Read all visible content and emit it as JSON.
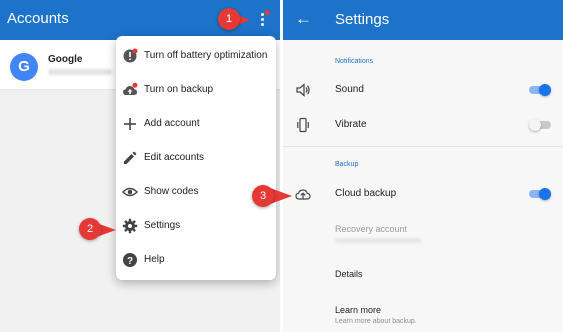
{
  "left": {
    "title": "Accounts",
    "account": {
      "avatar_letter": "G",
      "name": "Google"
    },
    "menu": [
      {
        "label": "Turn off battery optimization",
        "icon": "battery-alert-icon"
      },
      {
        "label": "Turn on backup",
        "icon": "cloud-upload-icon"
      },
      {
        "label": "Add account",
        "icon": "plus-icon"
      },
      {
        "label": "Edit accounts",
        "icon": "pencil-icon"
      },
      {
        "label": "Show codes",
        "icon": "eye-icon"
      },
      {
        "label": "Settings",
        "icon": "gear-icon"
      },
      {
        "label": "Help",
        "icon": "help-icon"
      }
    ]
  },
  "right": {
    "title": "Settings",
    "sections": {
      "notifications": "Notifications",
      "backup": "Backup"
    },
    "sound": {
      "label": "Sound",
      "on": true
    },
    "vibrate": {
      "label": "Vibrate",
      "on": false
    },
    "cloud_backup": {
      "label": "Cloud backup",
      "on": true
    },
    "recovery_account": "Recovery account",
    "details": "Details",
    "learn_more": {
      "title": "Learn more",
      "subtitle": "Learn more about backup."
    }
  },
  "callouts": {
    "one": "1",
    "two": "2",
    "three": "3"
  },
  "colors": {
    "appbar": "#1d72c9",
    "accent": "#1a73e8",
    "callout": "#e53935"
  }
}
